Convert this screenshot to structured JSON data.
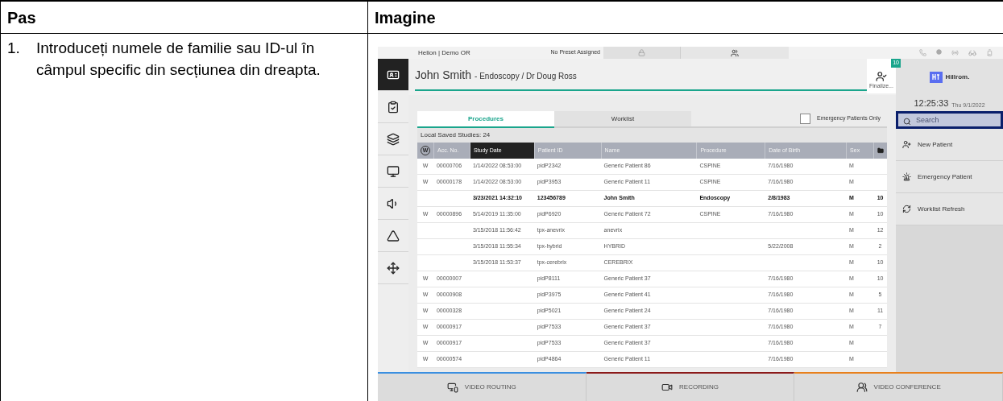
{
  "doc_table": {
    "headers": [
      "Pas",
      "Imagine"
    ],
    "step": {
      "number": "1.",
      "text": "Introduceți numele de familie sau ID-ul în câmpul specific din secțiunea din dreapta."
    }
  },
  "screen": {
    "status_bar": {
      "location": "Helion | Demo OR",
      "preset": "No Preset Assigned"
    },
    "sidebar": [
      {
        "selected": true
      },
      {
        "selected": false
      },
      {
        "selected": false
      },
      {
        "selected": false
      },
      {
        "selected": false
      },
      {
        "selected": false
      },
      {
        "selected": false
      }
    ],
    "patient": {
      "name": "John Smith",
      "detail": "- Endoscopy / Dr Doug Ross"
    },
    "finalize": {
      "label": "Finalize...",
      "badge": "10"
    },
    "tabs": [
      {
        "label": "Procedures",
        "selected": true
      },
      {
        "label": "Worklist",
        "selected": false
      }
    ],
    "emergency_only": {
      "label": "Emergency Patients Only",
      "checked": false
    },
    "studies_count": "Local Saved Studies: 24",
    "table": {
      "columns": [
        {
          "label": "W",
          "selected": false
        },
        {
          "label": "Acc. No.",
          "selected": false
        },
        {
          "label": "Study Date",
          "selected": true
        },
        {
          "label": "Patient ID",
          "selected": false
        },
        {
          "label": "Name",
          "selected": false
        },
        {
          "label": "Procedure",
          "selected": false
        },
        {
          "label": "Date of Birth",
          "selected": false
        },
        {
          "label": "Sex",
          "selected": false
        },
        {
          "selected": false
        }
      ],
      "rows": [
        {
          "current": false,
          "cells": [
            "W",
            "00000706",
            "1/14/2022 08:53:00",
            "pidP2342",
            "Generic Patient 86",
            "CSPINE",
            "7/16/1980",
            "M",
            ""
          ]
        },
        {
          "current": false,
          "cells": [
            "W",
            "00000178",
            "1/14/2022 08:53:00",
            "pidP3953",
            "Generic Patient 11",
            "CSPINE",
            "7/16/1980",
            "M",
            ""
          ]
        },
        {
          "current": true,
          "cells": [
            "",
            "",
            "3/23/2021 14:32:10",
            "123456789",
            "John Smith",
            "Endoscopy",
            "2/8/1983",
            "M",
            "10"
          ]
        },
        {
          "current": false,
          "cells": [
            "W",
            "00000896",
            "5/14/2019 11:35:00",
            "pidP6920",
            "Generic Patient 72",
            "CSPINE",
            "7/16/1980",
            "M",
            "10"
          ]
        },
        {
          "current": false,
          "cells": [
            "",
            "",
            "3/15/2018 11:56:42",
            "tpx-anevrix",
            "anevrix",
            "",
            "",
            "M",
            "12"
          ]
        },
        {
          "current": false,
          "cells": [
            "",
            "",
            "3/15/2018 11:55:34",
            "tpx-hybrid",
            "HYBRID",
            "",
            "5/22/2008",
            "M",
            "2"
          ]
        },
        {
          "current": false,
          "cells": [
            "",
            "",
            "3/15/2018 11:53:37",
            "tpx-cerebrix",
            "CEREBRIX",
            "",
            "",
            "M",
            "10"
          ]
        },
        {
          "current": false,
          "cells": [
            "W",
            "00000007",
            "",
            "pidP8111",
            "Generic Patient 37",
            "",
            "7/16/1980",
            "M",
            "10"
          ]
        },
        {
          "current": false,
          "cells": [
            "W",
            "00000908",
            "",
            "pidP3975",
            "Generic Patient 41",
            "",
            "7/16/1980",
            "M",
            "5"
          ]
        },
        {
          "current": false,
          "cells": [
            "W",
            "00000328",
            "",
            "pidP5021",
            "Generic Patient 24",
            "",
            "7/16/1980",
            "M",
            "11"
          ]
        },
        {
          "current": false,
          "cells": [
            "W",
            "00000917",
            "",
            "pidP7533",
            "Generic Patient 37",
            "",
            "7/16/1980",
            "M",
            "7"
          ]
        },
        {
          "current": false,
          "cells": [
            "W",
            "00000917",
            "",
            "pidP7533",
            "Generic Patient 37",
            "",
            "7/16/1980",
            "M",
            ""
          ]
        },
        {
          "current": false,
          "cells": [
            "W",
            "00000574",
            "",
            "pidP4864",
            "Generic Patient 11",
            "",
            "7/16/1980",
            "M",
            ""
          ]
        }
      ]
    },
    "brand": "Hillrom.",
    "clock": {
      "time": "12:25:33",
      "date": "Thu 9/1/2022"
    },
    "search": {
      "placeholder": "Search",
      "highlighted": true
    },
    "actions": [
      {
        "label": "New Patient"
      },
      {
        "label": "Emergency Patient"
      },
      {
        "label": "Worklist Refresh"
      }
    ],
    "bottom_bar": [
      {
        "label": "VIDEO ROUTING",
        "color": "#3b8fe0"
      },
      {
        "label": "RECORDING",
        "color": "#8b1a1a"
      },
      {
        "label": "VIDEO CONFERENCE",
        "color": "#e8801c"
      }
    ]
  }
}
